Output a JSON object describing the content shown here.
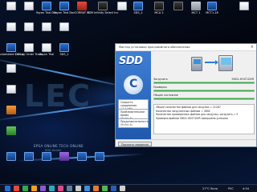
{
  "desktop": {
    "icons": [
      {
        "label": "",
        "kind": "doc"
      },
      {
        "label": "",
        "kind": "doc"
      },
      {
        "label": "Yoyon Trial Doc",
        "kind": "app"
      },
      {
        "label": "Yoyon Trial Doc",
        "kind": "app"
      },
      {
        "label": "CORRAT III",
        "kind": "red"
      },
      {
        "label": "SSM Infinity Select Inc",
        "kind": "dark"
      },
      {
        "label": "",
        "kind": "doc"
      },
      {
        "label": "SDS_2",
        "kind": "app"
      },
      {
        "label": "MCA 2",
        "kind": "dark"
      },
      {
        "label": "",
        "kind": "dark"
      },
      {
        "label": "MCT 1",
        "kind": "grey"
      },
      {
        "label": "MCT1-18",
        "kind": "app"
      },
      {
        "label": "",
        "kind": "doc"
      },
      {
        "label": "",
        "kind": "doc"
      },
      {
        "label": "",
        "kind": "doc"
      },
      {
        "label": "",
        "kind": "doc"
      },
      {
        "label": "",
        "kind": "doc"
      },
      {
        "label": "Automated Centre",
        "kind": "app"
      },
      {
        "label": "DEV.py Order Trade",
        "kind": "doc"
      },
      {
        "label": "Yoyon Trial",
        "kind": "doc"
      },
      {
        "label": "SDS_1",
        "kind": "app"
      },
      {
        "label": "",
        "kind": "doc"
      },
      {
        "label": "",
        "kind": "doc"
      },
      {
        "label": "",
        "kind": "orange"
      },
      {
        "label": "",
        "kind": "green"
      },
      {
        "label": "",
        "kind": "app"
      },
      {
        "label": "",
        "kind": "app"
      },
      {
        "label": "",
        "kind": "app"
      },
      {
        "label": "",
        "kind": "purple"
      },
      {
        "label": "",
        "kind": "app"
      },
      {
        "label": "",
        "kind": "app"
      }
    ],
    "wallpaper_text": "LEC",
    "wallpaper_caption": "EPSA ONLINE TECH ONLINE",
    "wallpaper_caption2": "SDD Dealer"
  },
  "wizard": {
    "title": "Мастер установки программного обеспечения",
    "close_glyph": "×",
    "logo_text": "SDD",
    "left_box_1_label": "Скорость соединения",
    "left_box_1_value": "17.4 (Mb)",
    "left_box_2_label": "Приблизительное время",
    "left_box_2_value": "0h:0m:4s",
    "left_box_3_label": "Продолжительность",
    "left_box_3_value": "0h:0m:4s",
    "row1_label": "Загрузить",
    "row1_value": "SHD1-HOST-DVR",
    "progress1": 1.0,
    "row2_label": "Проверка",
    "progress2": 1.0,
    "row3_label": "Общее состояние",
    "progress3": 1.0,
    "info_lines": [
      "Общее количество файлов для загрузки = 21287",
      "Количество загруженных файлов = 3854",
      "Количество проверенных файлов для загрузки, загрузить = 5",
      "Проверка файлов SHD1-HOST-DVR завершена успешно"
    ],
    "footer_button": "Показать сведения"
  },
  "taskbar": {
    "time": "4:54",
    "date": "",
    "temp": "27°C Ясно",
    "lang": "РУС",
    "colors": [
      "#1f6fd6",
      "#e04a3a",
      "#2fa84f",
      "#f0a020",
      "#8a5ad0",
      "#2fa8c9",
      "#d94b8a",
      "#5f7fa0",
      "#c9c9c9",
      "#3a8fe0",
      "#e07d30",
      "#56b356",
      "#2a5fb0",
      "#cfcfcf"
    ]
  }
}
